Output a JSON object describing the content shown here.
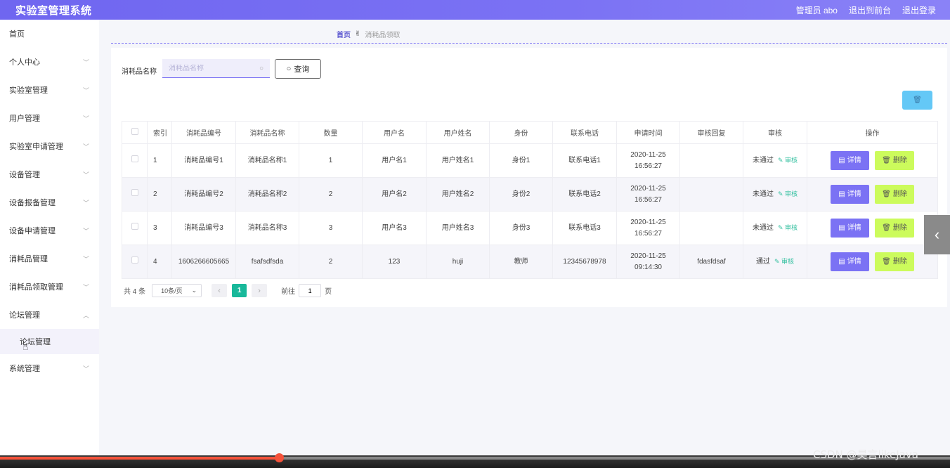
{
  "header": {
    "title": "实验室管理系统",
    "admin": "管理员 abo",
    "back_front": "退出到前台",
    "logout": "退出登录"
  },
  "sidebar": {
    "items": [
      {
        "label": "首页",
        "chevron": ""
      },
      {
        "label": "个人中心",
        "chevron": "﹀"
      },
      {
        "label": "实验室管理",
        "chevron": "﹀"
      },
      {
        "label": "用户管理",
        "chevron": "﹀"
      },
      {
        "label": "实验室申请管理",
        "chevron": "﹀"
      },
      {
        "label": "设备管理",
        "chevron": "﹀"
      },
      {
        "label": "设备报备管理",
        "chevron": "﹀"
      },
      {
        "label": "设备申请管理",
        "chevron": "﹀"
      },
      {
        "label": "消耗品管理",
        "chevron": "﹀"
      },
      {
        "label": "消耗品领取管理",
        "chevron": "﹀"
      },
      {
        "label": "论坛管理",
        "chevron": "︿"
      }
    ],
    "sub_item": "论坛管理",
    "last_item": {
      "label": "系统管理",
      "chevron": "﹀"
    }
  },
  "breadcrumb": {
    "home": "首页",
    "current": "消耗品领取"
  },
  "search": {
    "label": "消耗品名称",
    "placeholder": "消耗品名称",
    "button": "查询"
  },
  "table": {
    "headers": [
      "",
      "索引",
      "消耗品编号",
      "消耗品名称",
      "数量",
      "用户名",
      "用户姓名",
      "身份",
      "联系电话",
      "申请时间",
      "审核回复",
      "审核",
      "操作"
    ],
    "audit_link": "审核",
    "detail_label": "详情",
    "delete_label": "删除",
    "rows": [
      {
        "index": "1",
        "code": "消耗品编号1",
        "name": "消耗品名称1",
        "qty": "1",
        "username": "用户名1",
        "realname": "用户姓名1",
        "role": "身份1",
        "phone": "联系电话1",
        "time": "2020-11-25 16:56:27",
        "reply": "",
        "status": "未通过"
      },
      {
        "index": "2",
        "code": "消耗品编号2",
        "name": "消耗品名称2",
        "qty": "2",
        "username": "用户名2",
        "realname": "用户姓名2",
        "role": "身份2",
        "phone": "联系电话2",
        "time": "2020-11-25 16:56:27",
        "reply": "",
        "status": "未通过"
      },
      {
        "index": "3",
        "code": "消耗品编号3",
        "name": "消耗品名称3",
        "qty": "3",
        "username": "用户名3",
        "realname": "用户姓名3",
        "role": "身份3",
        "phone": "联系电话3",
        "time": "2020-11-25 16:56:27",
        "reply": "",
        "status": "未通过"
      },
      {
        "index": "4",
        "code": "1606266605665",
        "name": "fsafsdfsda",
        "qty": "2",
        "username": "123",
        "realname": "huji",
        "role": "教师",
        "phone": "12345678978",
        "time": "2020-11-25 09:14:30",
        "reply": "fdasfdsaf",
        "status": "通过"
      }
    ]
  },
  "pagination": {
    "total": "共 4 条",
    "page_size": "10条/页",
    "current_page": "1",
    "goto_label": "前往",
    "goto_value": "1",
    "page_unit": "页"
  },
  "watermark": "CSDN @昊言likeJava",
  "video": {
    "progress": 0.294
  },
  "colors": {
    "accent": "#7b72f4",
    "detail_button": "#7b72f4",
    "delete_button": "#ccfb5c",
    "active_page": "#18b89a",
    "audit_link": "#35c0a0"
  }
}
